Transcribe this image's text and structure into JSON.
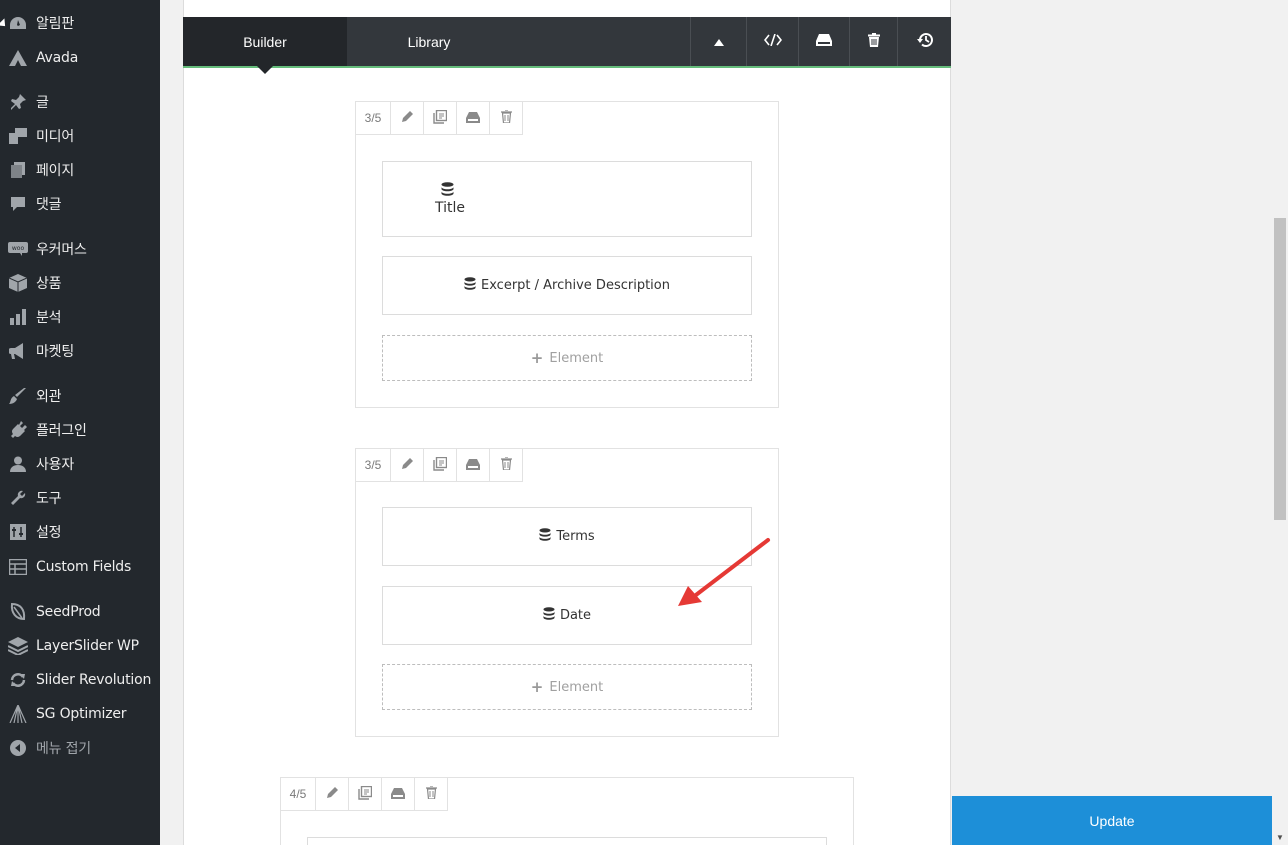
{
  "sidebar": {
    "items": [
      {
        "label": "알림판",
        "icon": "dashboard-icon"
      },
      {
        "label": "Avada",
        "icon": "avada-icon"
      },
      {
        "label": "글",
        "icon": "pin-icon"
      },
      {
        "label": "미디어",
        "icon": "media-icon"
      },
      {
        "label": "페이지",
        "icon": "page-icon"
      },
      {
        "label": "댓글",
        "icon": "comment-icon"
      },
      {
        "label": "우커머스",
        "icon": "woo-icon"
      },
      {
        "label": "상품",
        "icon": "box-icon"
      },
      {
        "label": "분석",
        "icon": "bar-chart-icon"
      },
      {
        "label": "마켓팅",
        "icon": "megaphone-icon"
      },
      {
        "label": "외관",
        "icon": "brush-icon"
      },
      {
        "label": "플러그인",
        "icon": "plugin-icon"
      },
      {
        "label": "사용자",
        "icon": "user-icon"
      },
      {
        "label": "도구",
        "icon": "wrench-icon"
      },
      {
        "label": "설정",
        "icon": "settings-icon"
      },
      {
        "label": "Custom Fields",
        "icon": "table-icon"
      },
      {
        "label": "SeedProd",
        "icon": "leaf-icon"
      },
      {
        "label": "LayerSlider WP",
        "icon": "layers-icon"
      },
      {
        "label": "Slider Revolution",
        "icon": "refresh-icon"
      },
      {
        "label": "SG Optimizer",
        "icon": "sg-icon"
      },
      {
        "label": "메뉴 접기",
        "icon": "collapse-icon"
      }
    ]
  },
  "builder": {
    "tab_builder": "Builder",
    "tab_library": "Library"
  },
  "containers": [
    {
      "size": "3/5",
      "elements": [
        "Title",
        "Excerpt / Archive Description"
      ],
      "add_label": "Element"
    },
    {
      "size": "3/5",
      "elements": [
        "Terms",
        "Date"
      ],
      "add_label": "Element"
    },
    {
      "size": "4/5"
    }
  ],
  "update_label": "Update",
  "colors": {
    "sidebar": "#23282d",
    "accent": "#1d8fd8",
    "bar": "#33373c",
    "annotation": "#e53935"
  }
}
